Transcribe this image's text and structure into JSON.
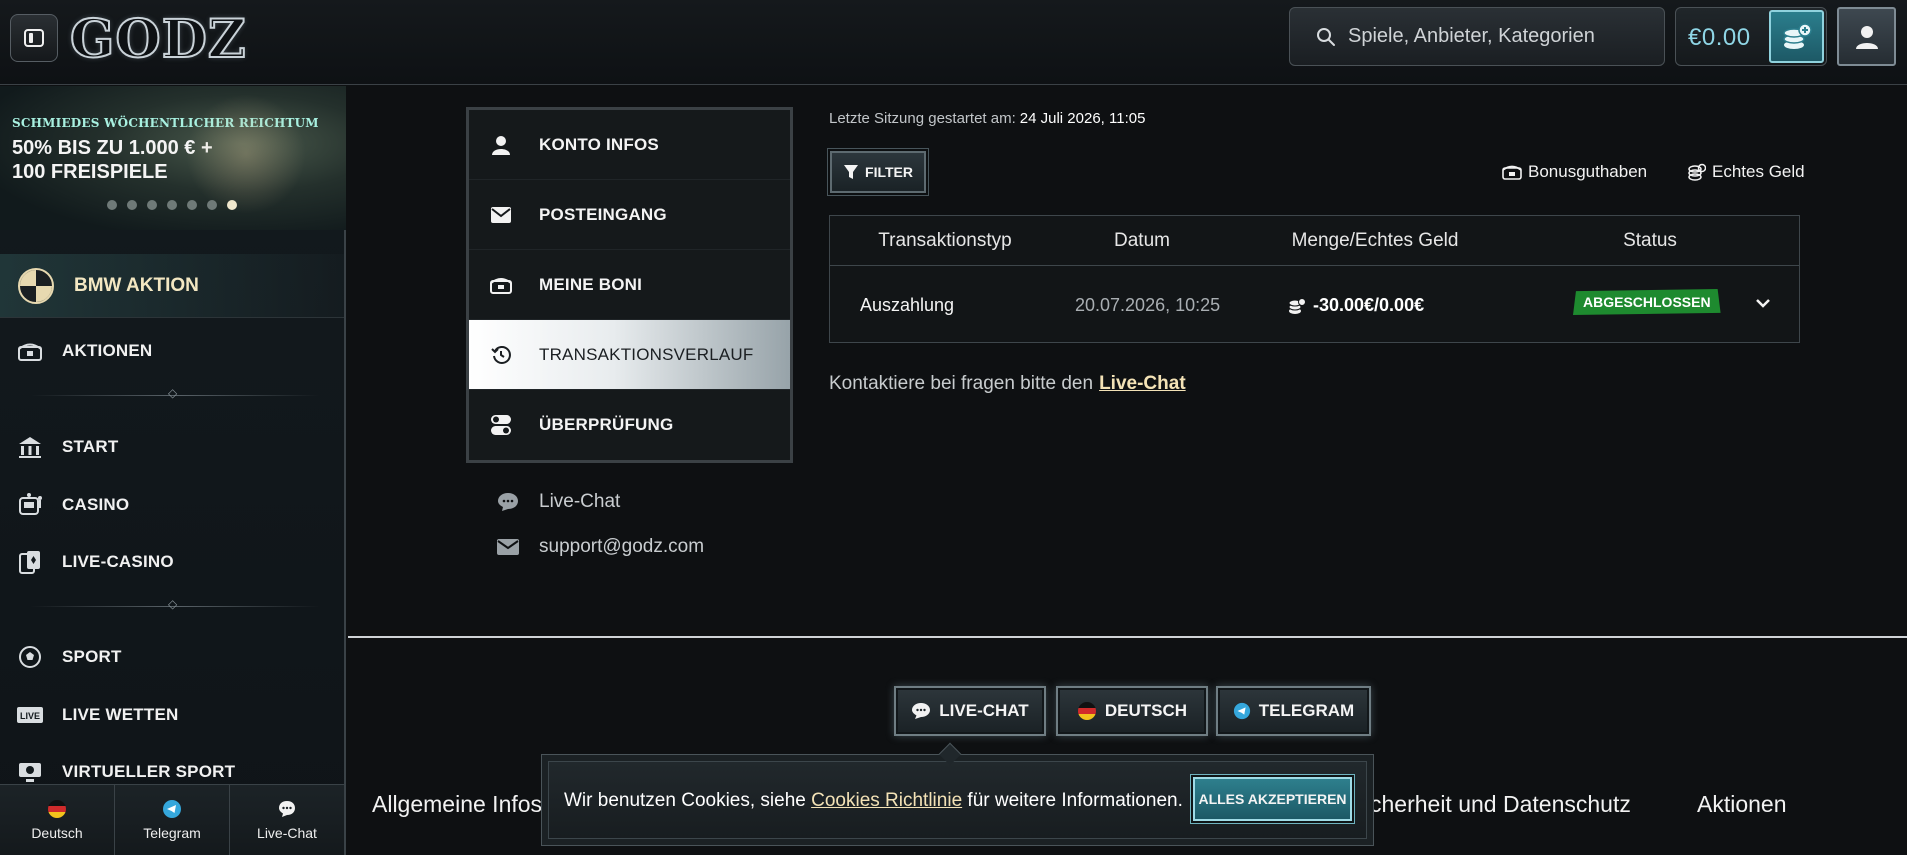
{
  "header": {
    "logo_text": "GODZ",
    "search_placeholder": "Spiele, Anbieter, Kategorien",
    "balance": "€0.00"
  },
  "sidebar": {
    "promo": {
      "subtitle": "SCHMIEDES WÖCHENTLICHER REICHTUM",
      "title": "50% BIS ZU 1.000 € + 100 FREISPIELE",
      "slide_count": 7,
      "active_slide": 7
    },
    "feature_item": "BMW AKTION",
    "items": [
      {
        "label": "AKTIONEN",
        "icon": "chest-icon"
      },
      {
        "label": "START",
        "icon": "temple-icon"
      },
      {
        "label": "CASINO",
        "icon": "slot-machine-icon"
      },
      {
        "label": "LIVE-CASINO",
        "icon": "cards-icon"
      },
      {
        "label": "SPORT",
        "icon": "soccer-ball-icon"
      },
      {
        "label": "LIVE WETTEN",
        "icon": "live-badge-icon"
      },
      {
        "label": "VIRTUELLER SPORT",
        "icon": "virtual-sport-icon"
      }
    ],
    "footer": {
      "language": "Deutsch",
      "telegram": "Telegram",
      "livechat": "Live-Chat"
    }
  },
  "account_menu": {
    "items": [
      {
        "label": "KONTO INFOS",
        "icon": "user-icon"
      },
      {
        "label": "POSTEINGANG",
        "icon": "envelope-icon"
      },
      {
        "label": "MEINE BONI",
        "icon": "treasure-icon"
      },
      {
        "label": "TRANSAKTIONSVERLAUF",
        "icon": "history-icon",
        "active": true
      },
      {
        "label": "ÜBERPRÜFUNG",
        "icon": "toggle-icon"
      }
    ],
    "contact": {
      "livechat": "Live-Chat",
      "email": "support@godz.com"
    }
  },
  "transactions": {
    "session_label": "Letzte Sitzung gestartet am:",
    "session_value": "24 Juli 2026, 11:05",
    "filter_label": "FILTER",
    "legend": {
      "bonus": "Bonusguthaben",
      "real": "Echtes Geld"
    },
    "columns": [
      "Transaktionstyp",
      "Datum",
      "Menge/Echtes Geld",
      "Status"
    ],
    "rows": [
      {
        "type": "Auszahlung",
        "date": "20.07.2026, 10:25",
        "amount": "-30.00€/0.00€",
        "status": "ABGESCHLOSSEN"
      }
    ],
    "help_text": "Kontaktiere bei fragen bitte den",
    "help_link": "Live-Chat"
  },
  "footer": {
    "buttons": {
      "livechat": "LIVE-CHAT",
      "language": "DEUTSCH",
      "telegram": "TELEGRAM"
    },
    "headings": {
      "general": "Allgemeine Infos",
      "security": "cherheit und Datenschutz",
      "promotions": "Aktionen"
    }
  },
  "cookie": {
    "text_before": "Wir benutzen Cookies, siehe ",
    "link": "Cookies Richtlinie",
    "text_after": " für weitere Informationen.",
    "accept": "ALLES AKZEPTIEREN"
  },
  "colors": {
    "accent_teal": "#2b7e8d",
    "gold_text": "#f3e2b6",
    "status_green": "#1e8a2f"
  }
}
